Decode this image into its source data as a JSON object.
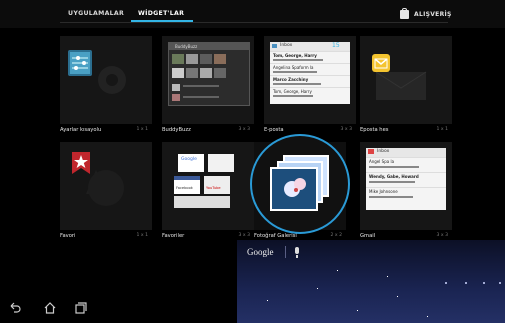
{
  "tabs": {
    "apps": "UYGULAMALAR",
    "widgets": "WİDGET'LAR"
  },
  "shop": {
    "label": "ALIŞVERİŞ",
    "icon": "shopping-bag-icon"
  },
  "widgets": [
    {
      "name": "Ayarlar kısayolu",
      "size": "1 x 1"
    },
    {
      "name": "BuddyBuzz",
      "size": "3 x 3"
    },
    {
      "name": "E-posta",
      "size": "3 x 3"
    },
    {
      "name": "Eposta hes",
      "size": "1 x 1"
    },
    {
      "name": "Favori",
      "size": "1 x 1"
    },
    {
      "name": "Favoriler",
      "size": "3 x 3"
    },
    {
      "name": "Fotoğraf Galerisi",
      "size": "2 x 2"
    },
    {
      "name": "Gmail",
      "size": "3 x 3"
    }
  ],
  "email_preview": {
    "inbox": "Inbox",
    "count": "15",
    "rows": [
      "Tom, George, Harry",
      "Angelina Spaform la",
      "Marco Zacchiny",
      "Tom, George, Harry"
    ]
  },
  "gmail_preview": {
    "inbox": "Inbox",
    "rows": [
      "Angel Spa la",
      "Wendy, Gabe, Howard",
      "Mike Johnsone"
    ]
  },
  "buddybuzz_preview": {
    "title": "BuddyBuzz"
  },
  "favorites_preview": {
    "tile1": "Google",
    "tile2": "Facebook",
    "tile3": "YouTube"
  },
  "google_bar": {
    "label": "Google"
  },
  "nav": {
    "back": "back-icon",
    "home": "home-icon",
    "recents": "recent-apps-icon"
  },
  "colors": {
    "accent": "#33b5e5",
    "background": "#000000"
  }
}
